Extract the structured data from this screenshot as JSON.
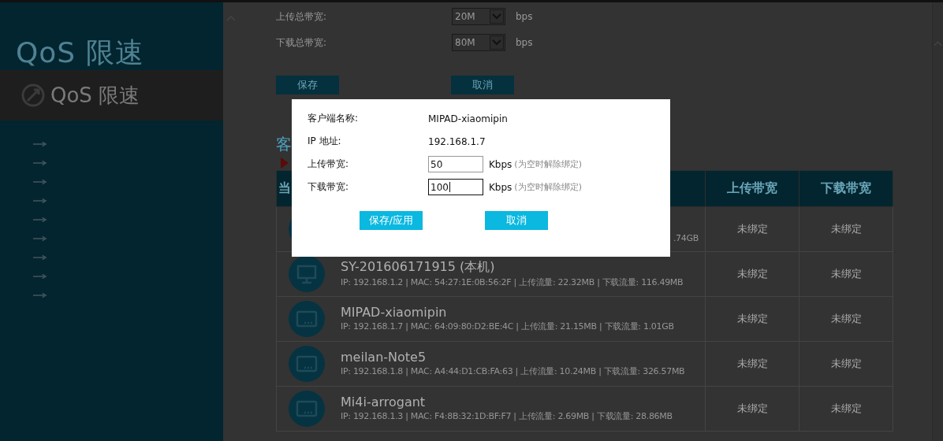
{
  "sidebar": {
    "brand": "QoS 限速",
    "active_item": "QoS 限速"
  },
  "main": {
    "bandwidth": [
      {
        "label": "上传总带宽:",
        "value": "20M",
        "unit": "bps"
      },
      {
        "label": "下载总带宽:",
        "value": "80M",
        "unit": "bps"
      }
    ],
    "buttons": [
      "保存",
      "取消"
    ],
    "section_title": "客",
    "table": {
      "columns": [
        "当",
        "上传带宽",
        "下载带宽"
      ],
      "rows": [
        {
          "kind": "unknown",
          "name": "",
          "details": ".74GB",
          "upload": "未绑定",
          "download": "未绑定"
        },
        {
          "kind": "desktop",
          "name": "SY-201606171915 (本机)",
          "details": "IP: 192.168.1.2 | MAC: 54:27:1E:0B:56:2F | 上传流量: 22.32MB | 下载流量: 116.49MB",
          "upload": "未绑定",
          "download": "未绑定"
        },
        {
          "kind": "tablet",
          "name": "MIPAD-xiaomipin",
          "details": "IP: 192.168.1.7 | MAC: 64:09:80:D2:BE:4C | 上传流量: 21.15MB | 下载流量: 1.01GB",
          "upload": "未绑定",
          "download": "未绑定"
        },
        {
          "kind": "tablet",
          "name": "meilan-Note5",
          "details": "IP: 192.168.1.8 | MAC: A4:44:D1:CB:FA:63 | 上传流量: 10.24MB | 下载流量: 326.57MB",
          "upload": "未绑定",
          "download": "未绑定"
        },
        {
          "kind": "tablet",
          "name": "Mi4i-arrogant",
          "details": "IP: 192.168.1.3 | MAC: F4:8B:32:1D:BF:F7 | 上传流量: 2.69MB | 下载流量: 28.86MB",
          "upload": "未绑定",
          "download": "未绑定"
        }
      ]
    }
  },
  "dialog": {
    "fields": [
      {
        "kind": "text",
        "label": "客户端名称:",
        "value": "MIPAD-xiaomipin"
      },
      {
        "kind": "text",
        "label": "IP 地址:",
        "value": "192.168.1.7"
      },
      {
        "kind": "input",
        "label": "上传带宽:",
        "value": "50",
        "unit": "Kbps",
        "hint": "(为空时解除绑定)",
        "focused": false
      },
      {
        "kind": "input",
        "label": "下载带宽:",
        "value": "100",
        "unit": "Kbps",
        "hint": "(为空时解除绑定)",
        "focused": true
      }
    ],
    "buttons": [
      "保存/应用",
      "取消"
    ]
  }
}
